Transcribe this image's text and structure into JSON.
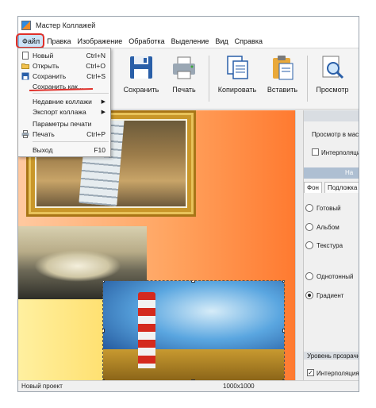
{
  "window": {
    "title": "Мастер Коллажей"
  },
  "menubar": {
    "items": [
      "Файл",
      "Правка",
      "Изображение",
      "Обработка",
      "Выделение",
      "Вид",
      "Справка"
    ]
  },
  "file_menu": {
    "items": [
      {
        "label": "Новый",
        "shortcut": "Ctrl+N",
        "icon": "new-file-icon"
      },
      {
        "label": "Открыть",
        "shortcut": "Ctrl+O",
        "icon": "open-folder-icon"
      },
      {
        "label": "Сохранить",
        "shortcut": "Ctrl+S",
        "icon": "save-icon"
      },
      {
        "label": "Сохранить как...",
        "shortcut": "",
        "icon": ""
      },
      {
        "label": "Недавние коллажи",
        "shortcut": "",
        "icon": "",
        "submenu": true
      },
      {
        "label": "Экспорт коллажа",
        "shortcut": "",
        "icon": "",
        "submenu": true
      },
      {
        "label": "Параметры печати",
        "shortcut": "",
        "icon": ""
      },
      {
        "label": "Печать",
        "shortcut": "Ctrl+P",
        "icon": "print-icon"
      },
      {
        "label": "Выход",
        "shortcut": "F10",
        "icon": ""
      }
    ]
  },
  "toolbar": {
    "buttons": [
      {
        "label": "Сохранить",
        "icon": "save-icon"
      },
      {
        "label": "Печать",
        "icon": "print-icon"
      },
      {
        "label": "Копировать",
        "icon": "copy-icon"
      },
      {
        "label": "Вставить",
        "icon": "paste-icon"
      },
      {
        "label": "Просмотр",
        "icon": "preview-icon"
      }
    ]
  },
  "right_panel": {
    "preview_label": "Просмотр в масшта",
    "interp_label": "Интерполяция с",
    "section_header": "На",
    "tabs": [
      "Фон",
      "Подложка"
    ],
    "radios": [
      "Готовый",
      "Альбом",
      "Текстура",
      "Однотонный",
      "Градиент"
    ],
    "selected_radio": "Градиент",
    "transparency_label": "Уровень прозрачнс",
    "interp2_label": "Интерполяция",
    "interp2_checked": true
  },
  "statusbar": {
    "project": "Новый проект",
    "size": "1000x1000"
  },
  "colors": {
    "highlight_red": "#e0302a",
    "menu_active_bg": "#cde4f7"
  }
}
